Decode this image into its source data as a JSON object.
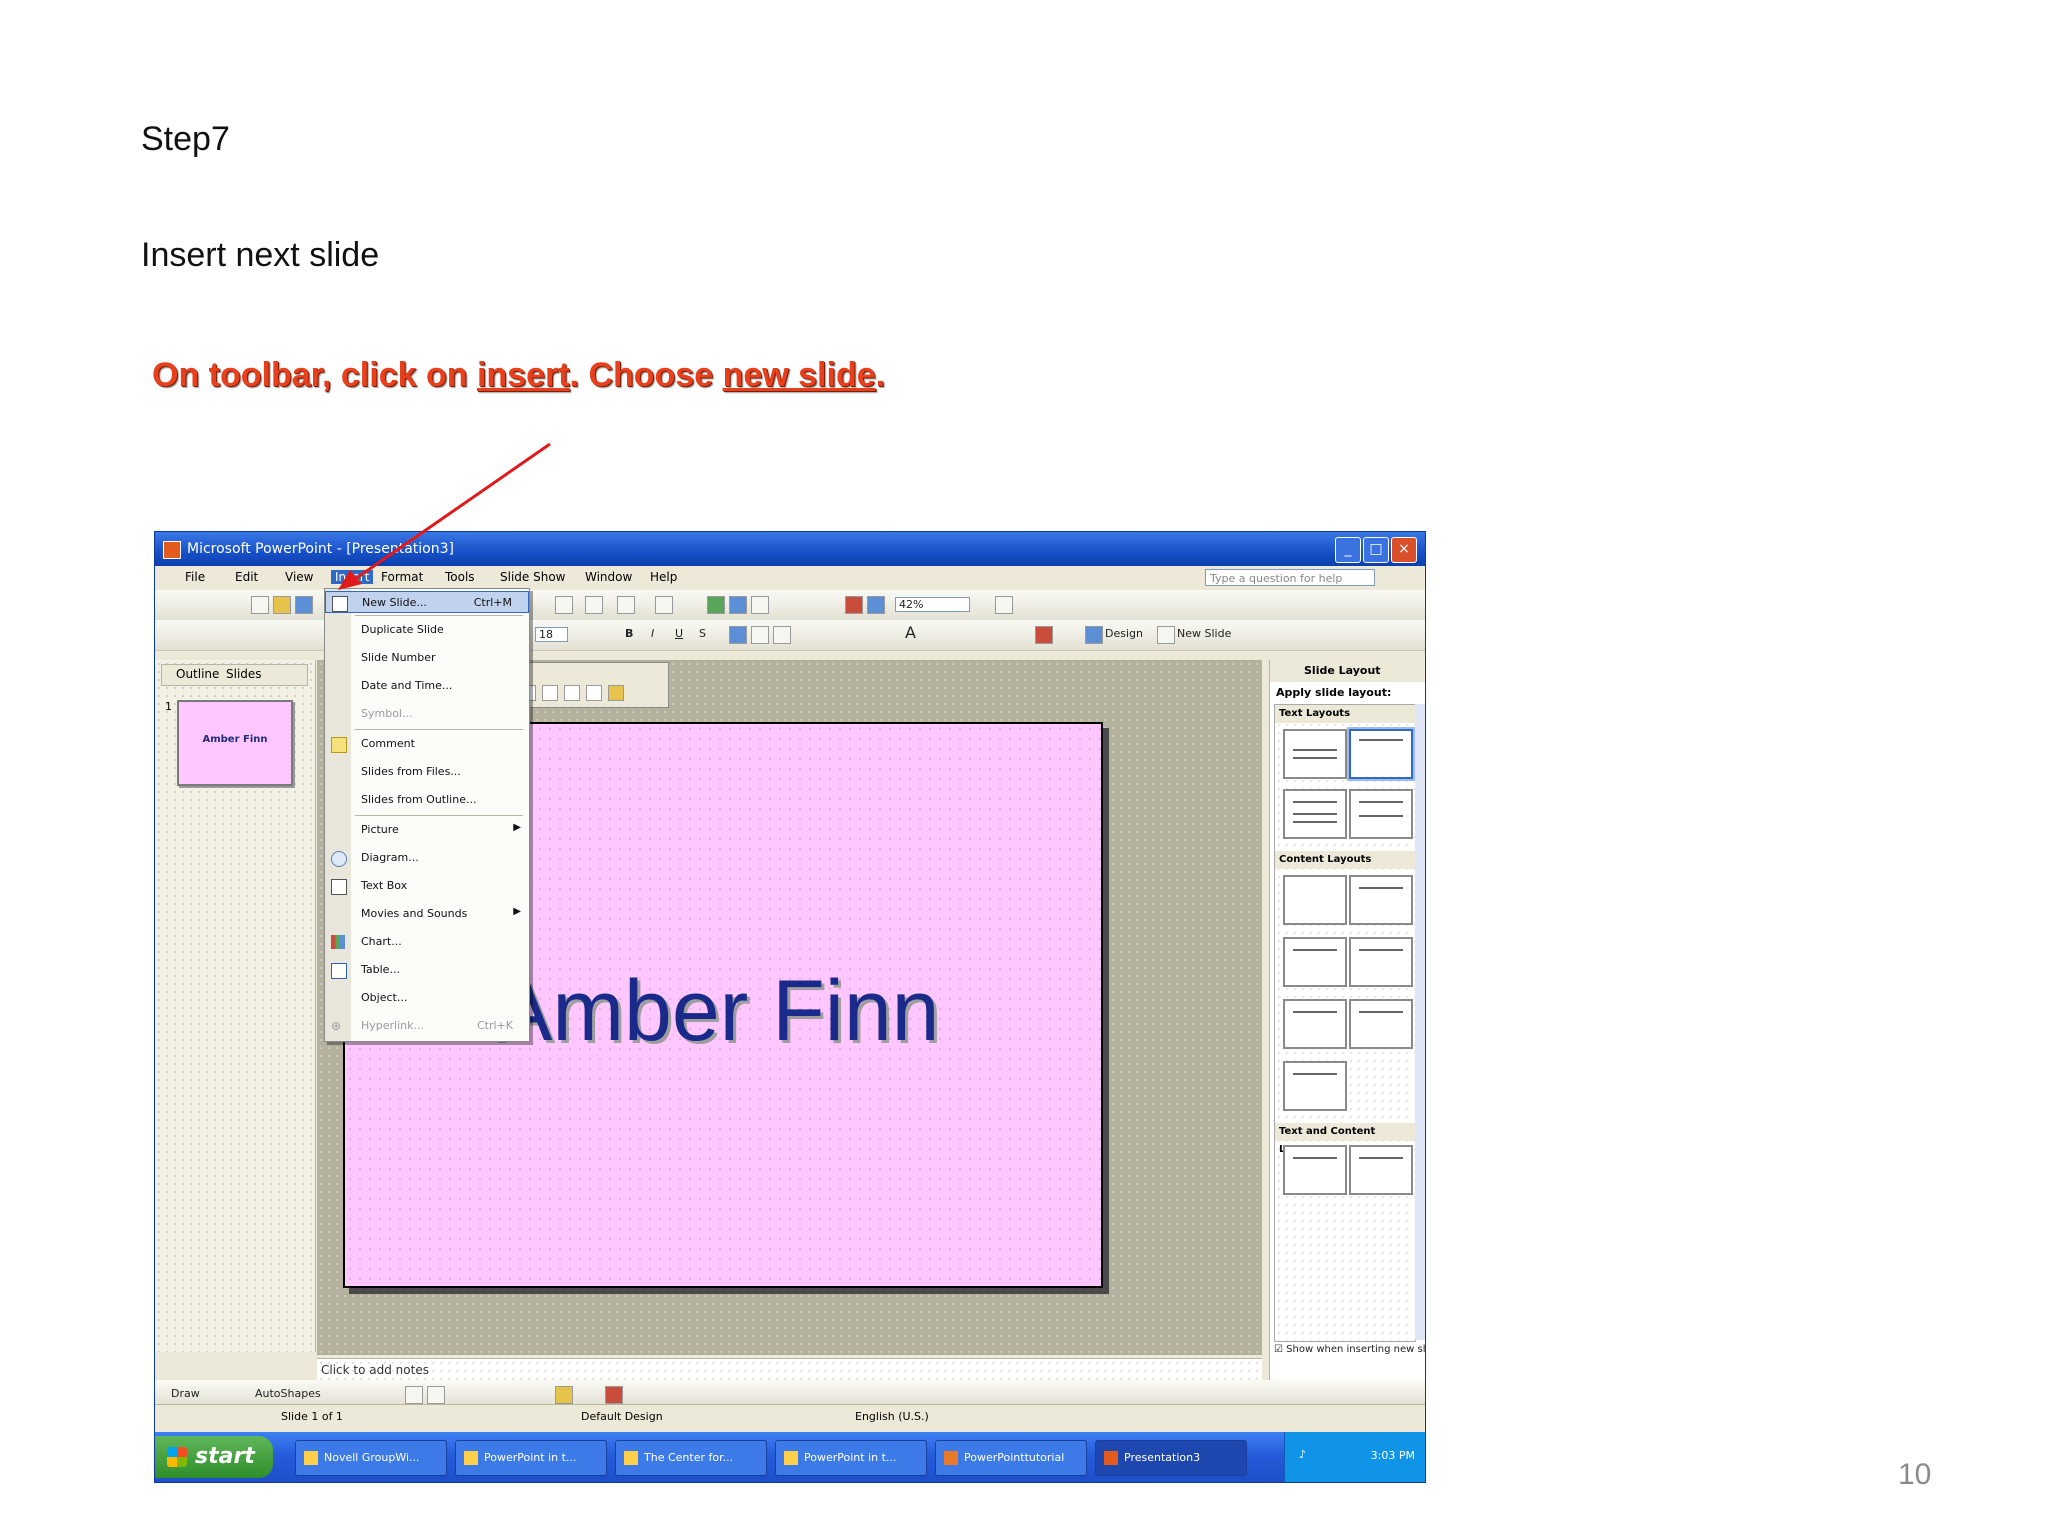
{
  "slide": {
    "step": "Step7",
    "subtitle": "Insert next slide",
    "instruction": {
      "prefix": "On toolbar, click on ",
      "link1": "insert",
      "middle": ". Choose ",
      "link2": "new slide",
      "suffix": "."
    },
    "page_number": "10"
  },
  "window": {
    "title": "Microsoft PowerPoint - [Presentation3]",
    "menu": [
      "File",
      "Edit",
      "View",
      "Insert",
      "Format",
      "Tools",
      "Slide Show",
      "Window",
      "Help"
    ],
    "active_menu": "Insert",
    "help_placeholder": "Type a question for help",
    "zoom": "42%",
    "font_size": "18",
    "toolbar_design": "Design",
    "toolbar_new_slide": "New Slide"
  },
  "dropdown": {
    "items": [
      {
        "label": "New Slide...",
        "shortcut": "Ctrl+M",
        "highlighted": true
      },
      {
        "label": "Duplicate Slide"
      },
      {
        "label": "Slide Number"
      },
      {
        "label": "Date and Time..."
      },
      {
        "label": "Symbol...",
        "disabled": true
      },
      {
        "label": "Comment"
      },
      {
        "label": "Slides from Files..."
      },
      {
        "label": "Slides from Outline..."
      },
      {
        "label": "Picture",
        "submenu": true
      },
      {
        "label": "Diagram..."
      },
      {
        "label": "Text Box"
      },
      {
        "label": "Movies and Sounds",
        "submenu": true
      },
      {
        "label": "Chart..."
      },
      {
        "label": "Table..."
      },
      {
        "label": "Object..."
      },
      {
        "label": "Hyperlink...",
        "shortcut": "Ctrl+K",
        "disabled": true
      }
    ]
  },
  "outline": {
    "tabs": [
      "Outline",
      "Slides"
    ],
    "thumb_text": "Amber Finn",
    "thumb_number": "1"
  },
  "slide_content": {
    "title": "Amber Finn"
  },
  "notes": {
    "placeholder": "Click to add notes"
  },
  "taskpane": {
    "title": "Slide Layout",
    "apply": "Apply slide layout:",
    "sections": [
      "Text Layouts",
      "Content Layouts",
      "Text and Content Layouts"
    ],
    "show_checkbox": "Show when inserting new slides"
  },
  "drawbar": {
    "draw": "Draw",
    "autoshapes": "AutoShapes"
  },
  "statusbar": {
    "slide": "Slide 1 of 1",
    "design": "Default Design",
    "language": "English (U.S.)"
  },
  "taskbar": {
    "start": "start",
    "tasks": [
      "Novell GroupWi...",
      "PowerPoint in t...",
      "The Center for...",
      "PowerPoint in t...",
      "PowerPointtutorial",
      "Presentation3"
    ],
    "clock": "3:03 PM"
  },
  "colors": {
    "instruction": "#e8401c",
    "slide_bg": "#ffc6ff",
    "slide_title": "#1a2a8a",
    "arrow": "#e01a1a",
    "titlebar": "#1650c8"
  }
}
